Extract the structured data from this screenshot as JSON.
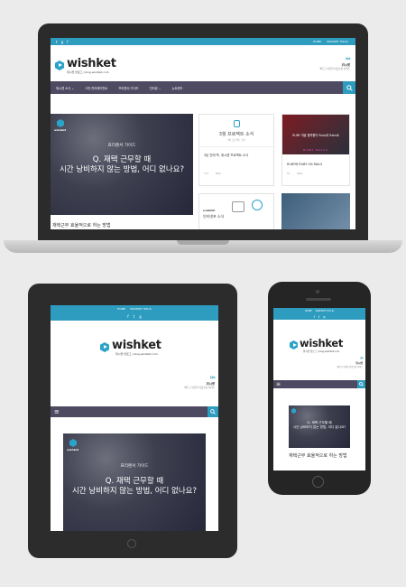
{
  "site": {
    "logo_text": "wishket",
    "logo_sub": "위시켓 블로그 | blog.wishket.com",
    "top_links": [
      "HOME",
      "WISHKET HOLIC"
    ],
    "social": [
      "t",
      "g",
      "f"
    ],
    "ad_title": "위시켓",
    "ad_sub": "빠르고 안전한 아웃소싱 서비스",
    "nav": [
      "위시켓 소식 ⌄",
      "그런 관리레이먼트",
      "프리랜서 가이드",
      "인터뷰 ⌄",
      "뉴트렌드"
    ],
    "search_icon": "search-icon",
    "menu_icon": "hamburger-menu-icon"
  },
  "hero": {
    "brand": "wishket",
    "tag": "프리랜서 가이드",
    "headline_1": "Q. 재택 근무할 때",
    "headline_2": "시간 낭비하지 않는 방법, 어디 없나요?",
    "tablet_headline_2": "시간 낭비하지 않는 방법, 어디 없나요?",
    "phone_headline_1": "Q. 재택 근무할 때",
    "phone_headline_2": "시간 낭비하지 않는 방법, 어디 없나요?"
  },
  "laptop_cards": {
    "news_title": "3월 프로젝트 소식",
    "news_sub": "3월 프로젝트 소식",
    "news_caption": "3분 안에 쏙, 위시켓 프로젝트 소식",
    "news_count_1": "173",
    "news_count_2": "Wstu",
    "ruby_title": "RUBY 개발 플랫폼이 Ruby와 Rails로",
    "ruby_caption": "RUBY와 RUBY ON RAILS",
    "ruby_count_1": "53",
    "ruby_count_2": "Wstu",
    "ruby_banner": "RUBY  RAILS",
    "lower_label": "e-sketch",
    "lower_title": "인터넷포 소식",
    "below_hero": "재택근무 효율적으로 하는 방법"
  },
  "phone_cards": {
    "below_hero": "재택근무 효율적으로 하는 방법"
  }
}
